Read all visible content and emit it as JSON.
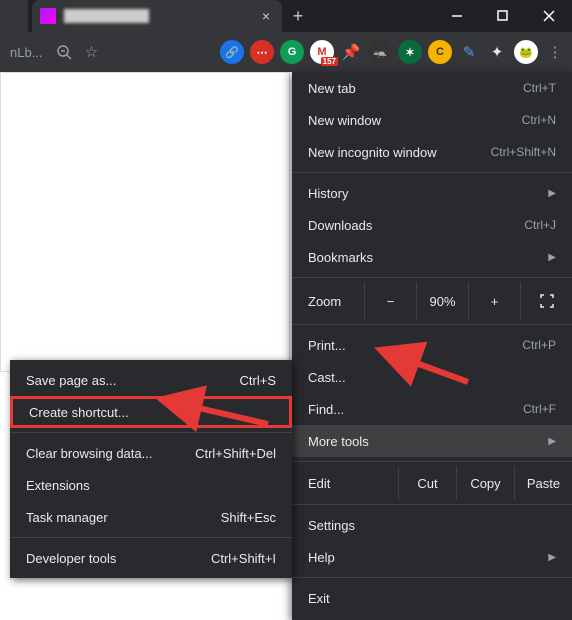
{
  "titlebar": {
    "tab_title": "██████████",
    "close_glyph": "×",
    "newtab_glyph": "+"
  },
  "toolbar": {
    "addr_fragment": "nLb...",
    "badge_count": "157"
  },
  "menu": {
    "new_tab": "New tab",
    "new_tab_sc": "Ctrl+T",
    "new_window": "New window",
    "new_window_sc": "Ctrl+N",
    "new_incognito": "New incognito window",
    "new_incognito_sc": "Ctrl+Shift+N",
    "history": "History",
    "downloads": "Downloads",
    "downloads_sc": "Ctrl+J",
    "bookmarks": "Bookmarks",
    "zoom": "Zoom",
    "zoom_minus": "−",
    "zoom_val": "90%",
    "zoom_plus": "+",
    "print": "Print...",
    "print_sc": "Ctrl+P",
    "cast": "Cast...",
    "find": "Find...",
    "find_sc": "Ctrl+F",
    "more_tools": "More tools",
    "edit": "Edit",
    "cut": "Cut",
    "copy": "Copy",
    "paste": "Paste",
    "settings": "Settings",
    "help": "Help",
    "exit": "Exit",
    "chev": "▶"
  },
  "submenu": {
    "save_page": "Save page as...",
    "save_page_sc": "Ctrl+S",
    "create_shortcut": "Create shortcut...",
    "clear_data": "Clear browsing data...",
    "clear_data_sc": "Ctrl+Shift+Del",
    "extensions": "Extensions",
    "task_manager": "Task manager",
    "task_manager_sc": "Shift+Esc",
    "dev_tools": "Developer tools",
    "dev_tools_sc": "Ctrl+Shift+I"
  }
}
